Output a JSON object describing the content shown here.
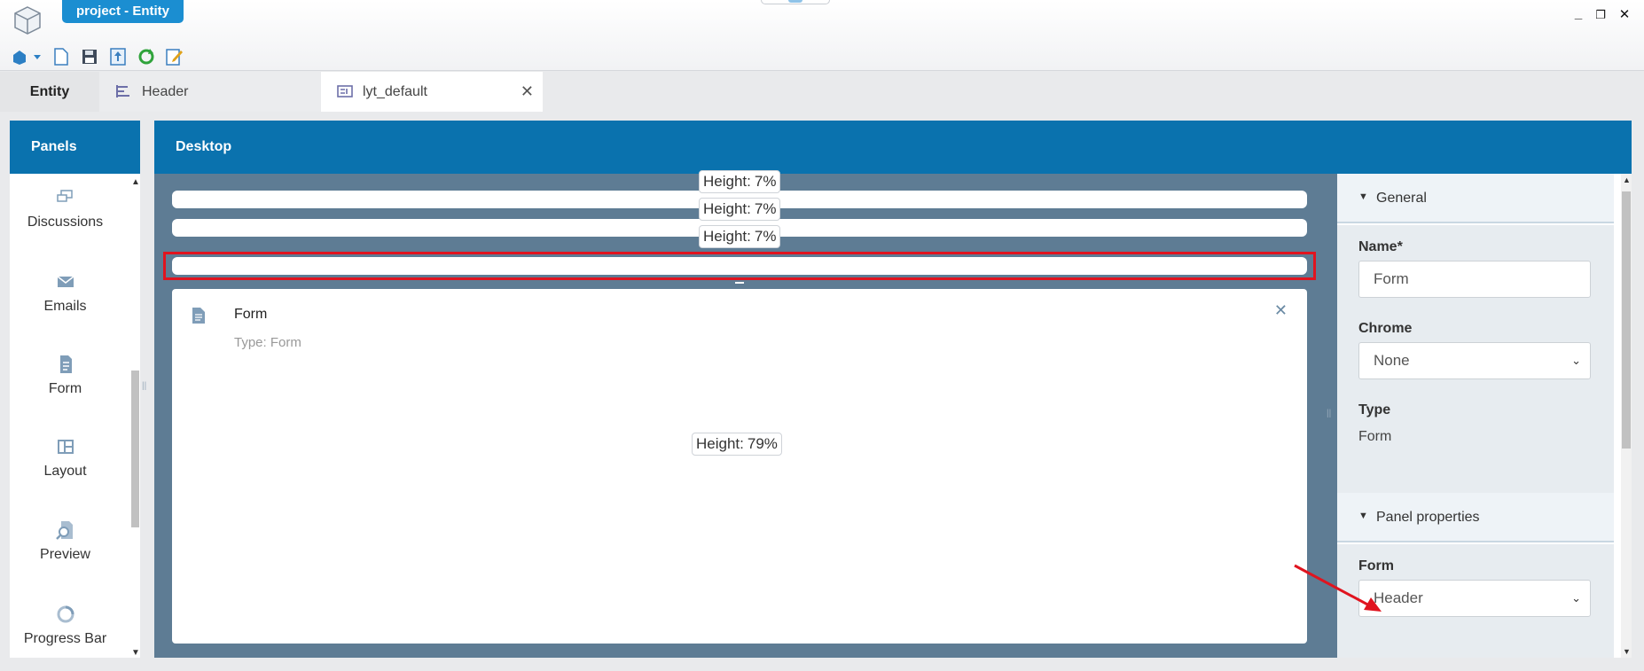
{
  "window": {
    "title": "project - Entity"
  },
  "toolbar": {
    "icons": [
      "entity-dropdown-icon",
      "new-document-icon",
      "save-icon",
      "export-icon",
      "refresh-icon",
      "edit-icon"
    ]
  },
  "tabs": [
    {
      "label": "Entity"
    },
    {
      "label": "Header"
    },
    {
      "label": "lyt_default"
    }
  ],
  "panels": {
    "title": "Panels",
    "items": [
      {
        "label": "Discussions"
      },
      {
        "label": "Emails"
      },
      {
        "label": "Form"
      },
      {
        "label": "Layout"
      },
      {
        "label": "Preview"
      },
      {
        "label": "Progress Bar"
      }
    ]
  },
  "desktop": {
    "title": "Desktop",
    "rows": [
      {
        "height_label": "Height:",
        "height_value": "7%"
      },
      {
        "height_label": "Height:",
        "height_value": "7%"
      },
      {
        "height_label": "Height:",
        "height_value": "7%"
      }
    ],
    "form_panel": {
      "title": "Form",
      "type_text": "Type: Form",
      "height_label": "Height:",
      "height_value": "79%"
    }
  },
  "properties": {
    "general": {
      "title": "General",
      "name_label": "Name*",
      "name_value": "Form",
      "chrome_label": "Chrome",
      "chrome_value": "None",
      "type_label": "Type",
      "type_value": "Form"
    },
    "panel_properties": {
      "title": "Panel properties",
      "form_label": "Form",
      "form_value": "Header"
    }
  },
  "colors": {
    "accent": "#0a72ae",
    "canvas": "#5e7c94",
    "selection": "#e0141f",
    "title_tag": "#1b8ed1"
  }
}
